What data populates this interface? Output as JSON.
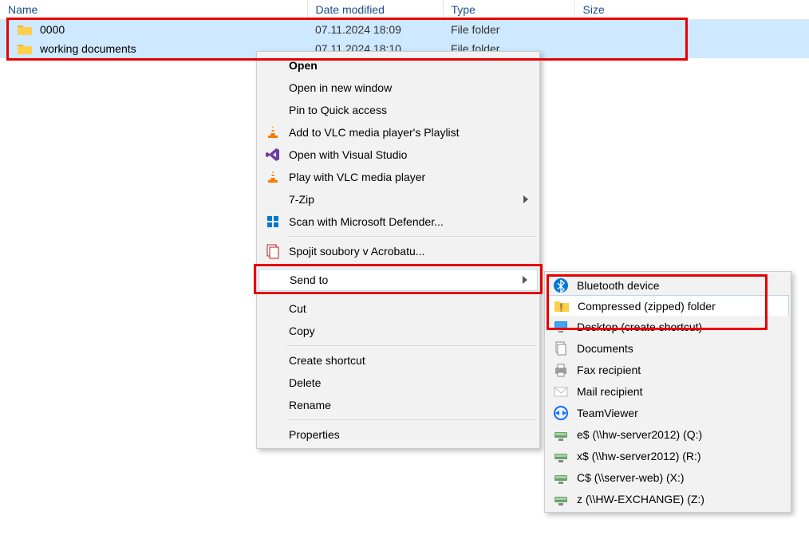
{
  "columns": {
    "name": "Name",
    "date": "Date modified",
    "type": "Type",
    "size": "Size"
  },
  "rows": [
    {
      "name": "0000",
      "date": "07.11.2024 18:09",
      "type": "File folder"
    },
    {
      "name": "working documents",
      "date": "07.11.2024 18:10",
      "type": "File folder"
    }
  ],
  "menu": {
    "open": "Open",
    "open_new_window": "Open in new window",
    "pin_qa": "Pin to Quick access",
    "vlc_playlist": "Add to VLC media player's Playlist",
    "open_vs": "Open with Visual Studio",
    "vlc_play": "Play with VLC media player",
    "sevenzip": "7-Zip",
    "defender": "Scan with Microsoft Defender...",
    "acrobat_merge": "Spojit soubory v Acrobatu...",
    "send_to": "Send to",
    "cut": "Cut",
    "copy": "Copy",
    "create_shortcut": "Create shortcut",
    "delete": "Delete",
    "rename": "Rename",
    "properties": "Properties"
  },
  "submenu": {
    "bluetooth": "Bluetooth device",
    "zip": "Compressed (zipped) folder",
    "desktop": "Desktop (create shortcut)",
    "documents": "Documents",
    "fax": "Fax recipient",
    "mail": "Mail recipient",
    "teamviewer": "TeamViewer",
    "drive_q": "e$ (\\\\hw-server2012) (Q:)",
    "drive_r": "x$ (\\\\hw-server2012) (R:)",
    "drive_x": "C$ (\\\\server-web) (X:)",
    "drive_z": "z (\\\\HW-EXCHANGE) (Z:)"
  }
}
